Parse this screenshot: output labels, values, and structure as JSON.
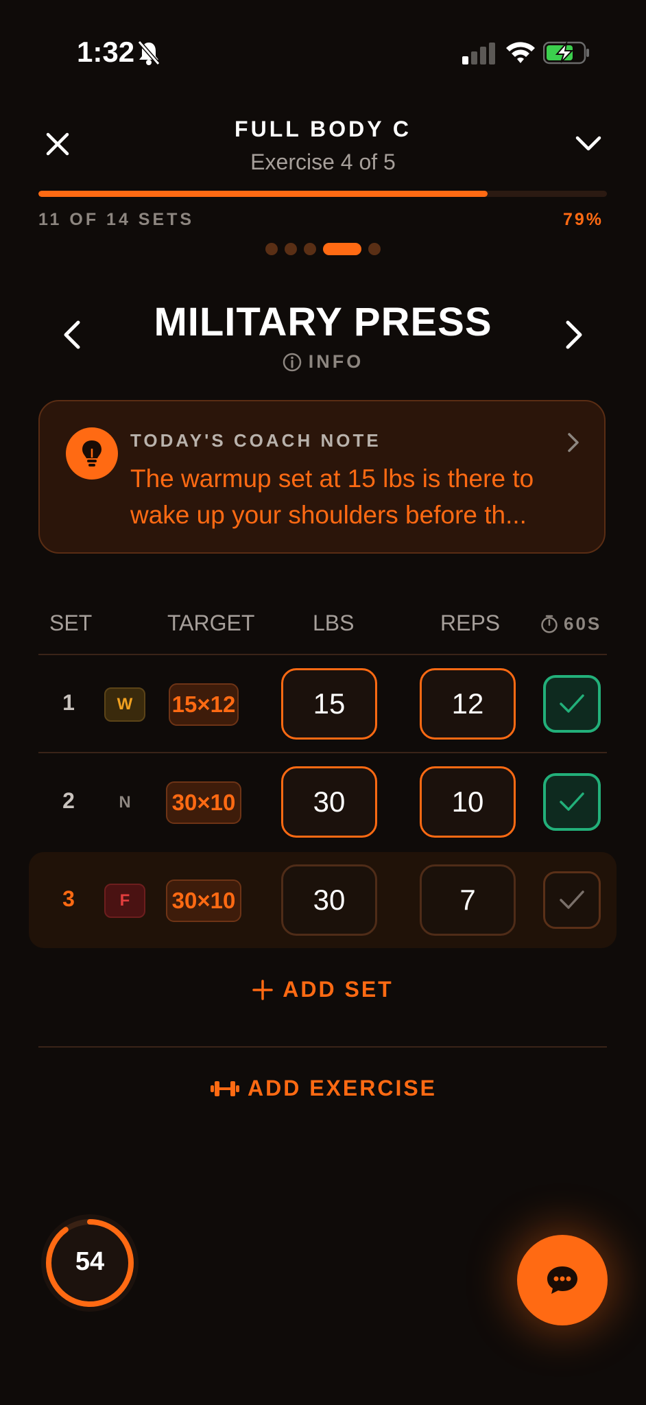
{
  "status_bar": {
    "time": "1:32"
  },
  "header": {
    "title": "FULL BODY C",
    "subtitle": "Exercise 4 of 5",
    "progress_fraction": 0.79,
    "sets_label": "11 OF 14 SETS",
    "percent_label": "79%"
  },
  "pager": {
    "count": 5,
    "active_index": 3
  },
  "exercise": {
    "name": "MILITARY PRESS",
    "info_label": "INFO"
  },
  "coach_note": {
    "label": "TODAY'S COACH NOTE",
    "text": "The warmup set at 15 lbs is there to wake up your shoulders before th..."
  },
  "table": {
    "headers": {
      "set": "SET",
      "target": "TARGET",
      "lbs": "LBS",
      "reps": "REPS",
      "timer": "60S"
    },
    "rows": [
      {
        "set": "1",
        "type": "W",
        "target": "15×12",
        "lbs": "15",
        "reps": "12",
        "done": true
      },
      {
        "set": "2",
        "type": "N",
        "target": "30×10",
        "lbs": "30",
        "reps": "10",
        "done": true
      },
      {
        "set": "3",
        "type": "F",
        "target": "30×10",
        "lbs": "30",
        "reps": "7",
        "done": false
      }
    ]
  },
  "actions": {
    "add_set": "ADD SET",
    "add_exercise": "ADD EXERCISE"
  },
  "rest_timer": {
    "value": "54",
    "progress_fraction": 0.9
  },
  "colors": {
    "accent": "#ff6a13",
    "success": "#22b07a",
    "background": "#0f0b09"
  }
}
